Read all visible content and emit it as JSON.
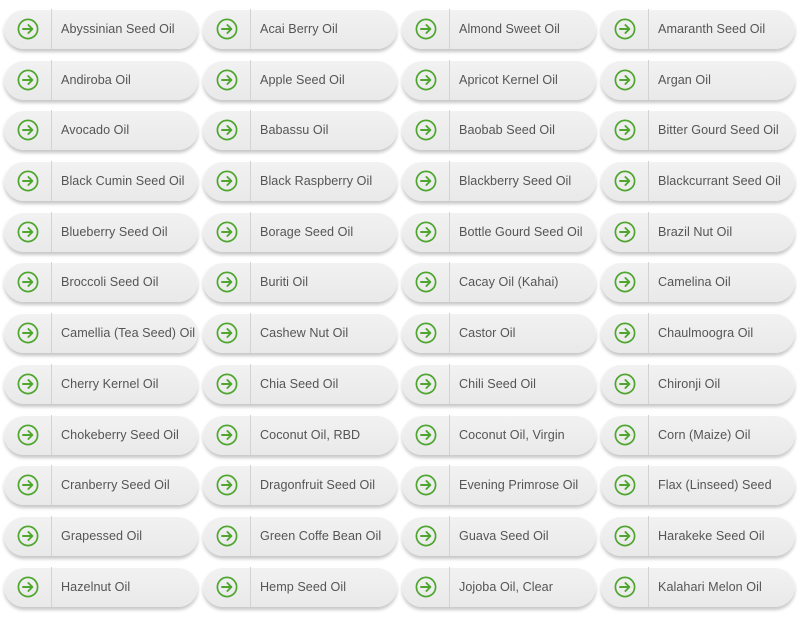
{
  "colors": {
    "accent": "#4ea62f",
    "text": "#555555",
    "pill_bg": "#efefef"
  },
  "icon": "arrow-right-circle-icon",
  "items": [
    "Abyssinian Seed Oil",
    "Acai Berry Oil",
    "Almond Sweet Oil",
    "Amaranth Seed Oil",
    "Andiroba Oil",
    "Apple Seed Oil",
    "Apricot Kernel Oil",
    "Argan Oil",
    "Avocado Oil",
    "Babassu Oil",
    "Baobab Seed Oil",
    "Bitter Gourd Seed Oil",
    "Black Cumin Seed Oil",
    "Black Raspberry Oil",
    "Blackberry Seed Oil",
    "Blackcurrant Seed Oil",
    "Blueberry Seed Oil",
    "Borage Seed Oil",
    "Bottle Gourd Seed Oil",
    "Brazil Nut Oil",
    "Broccoli Seed Oil",
    "Buriti Oil",
    "Cacay Oil (Kahai)",
    "Camelina Oil",
    "Camellia (Tea Seed) Oil",
    "Cashew Nut Oil",
    "Castor Oil",
    "Chaulmoogra Oil",
    "Cherry Kernel Oil",
    "Chia Seed Oil",
    "Chili Seed Oil",
    "Chironji Oil",
    "Chokeberry Seed Oil",
    "Coconut Oil, RBD",
    "Coconut Oil, Virgin",
    "Corn (Maize) Oil",
    "Cranberry Seed Oil",
    "Dragonfruit Seed Oil",
    "Evening Primrose Oil",
    "Flax (Linseed) Seed",
    "Grapessed Oil",
    "Green Coffe Bean Oil",
    "Guava Seed Oil",
    "Harakeke Seed Oil",
    "Hazelnut Oil",
    "Hemp Seed Oil",
    "Jojoba Oil, Clear",
    "Kalahari Melon Oil"
  ]
}
